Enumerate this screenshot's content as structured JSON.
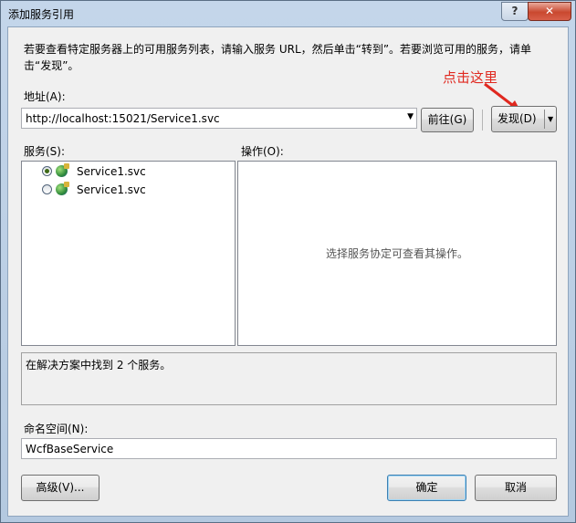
{
  "window": {
    "title": "添加服务引用",
    "help_label": "?",
    "close_label": "✕"
  },
  "description": "若要查看特定服务器上的可用服务列表，请输入服务 URL，然后单击“转到”。若要浏览可用的服务，请单击“发现”。",
  "address": {
    "label": "地址(A):",
    "value": "http://localhost:15021/Service1.svc",
    "go_label": "前往(G)",
    "discover_label": "发现(D)"
  },
  "annotation": "点击这里",
  "services": {
    "label": "服务(S):",
    "items": [
      {
        "label": "Service1.svc",
        "selected": true
      },
      {
        "label": "Service1.svc",
        "selected": false
      }
    ]
  },
  "operations": {
    "label": "操作(O):",
    "placeholder": "选择服务协定可查看其操作。"
  },
  "status_text": "在解决方案中找到 2 个服务。",
  "namespace": {
    "label": "命名空间(N):",
    "value": "WcfBaseService"
  },
  "buttons": {
    "advanced": "高级(V)...",
    "ok": "确定",
    "cancel": "取消"
  },
  "colors": {
    "annotation": "#e0281f",
    "title_bar": "#c4d6ea"
  }
}
